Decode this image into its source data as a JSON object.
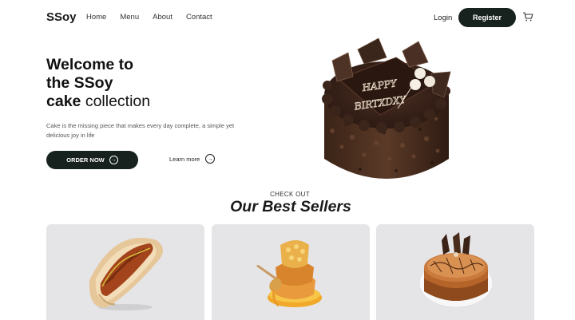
{
  "nav": {
    "brand": "SSoy",
    "links": [
      "Home",
      "Menu",
      "About",
      "Contact"
    ],
    "login": "Login",
    "register": "Register",
    "cart_icon": "cart-icon"
  },
  "hero": {
    "title_line1": "Welcome to",
    "title_line2": "the SSoy",
    "title_line3_bold": "cake ",
    "title_line3_light": "collection",
    "description": "Cake is the missing piece that makes every day complete, a simple yet delicious joy in life",
    "order_button": "ORDER NOW",
    "learn_more": "Learn more",
    "cake_text": "HAPPY BIRTXDXY"
  },
  "best_sellers": {
    "kicker": "CHECK OUT",
    "title": "Our Best Sellers",
    "items": [
      {
        "image": "hot-dog"
      },
      {
        "image": "honey-cake"
      },
      {
        "image": "caramel-cake"
      }
    ]
  },
  "colors": {
    "dark_button": "#17211e",
    "card_bg": "#e5e5e8"
  }
}
